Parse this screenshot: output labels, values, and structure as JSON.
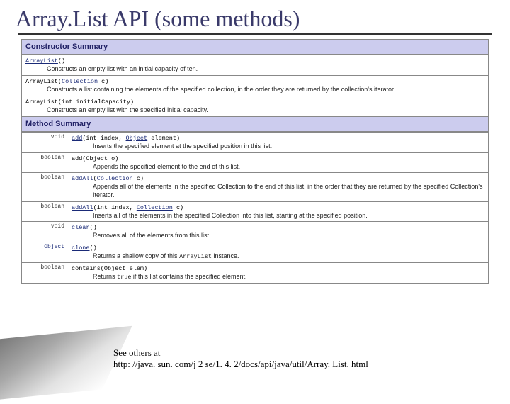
{
  "title": "Array.List API (some methods)",
  "constructor_header": "Constructor Summary",
  "method_header": "Method Summary",
  "constructors": [
    {
      "sig_pre": "ArrayList",
      "sig_post": "()",
      "desc": "Constructs an empty list with an initial capacity of ten."
    },
    {
      "sig_pre": "ArrayList",
      "sig_arg": "Collection",
      "sig_var": " c)",
      "desc": "Constructs a list containing the elements of the specified collection, in the order they are returned by the collection's iterator."
    },
    {
      "sig_pre": "ArrayList",
      "sig_post": "(int initialCapacity)",
      "desc": "Constructs an empty list with the specified initial capacity."
    }
  ],
  "methods": [
    {
      "ret": "void",
      "name": "add",
      "sig": "(int index, ",
      "argtype": "Object",
      "sig2": " element)",
      "desc": "Inserts the specified element at the specified position in this list."
    },
    {
      "ret": "boolean",
      "name_plain": "add(Object o)",
      "desc": "Appends the specified element to the end of this list."
    },
    {
      "ret": "boolean",
      "name": "addAll",
      "sig": "(",
      "argtype": "Collection",
      "sig2": " c)",
      "desc": "Appends all of the elements in the specified Collection to the end of this list, in the order that they are returned by the specified Collection's Iterator."
    },
    {
      "ret": "boolean",
      "name": "addAll",
      "sig": "(int index, ",
      "argtype": "Collection",
      "sig2": " c)",
      "desc": "Inserts all of the elements in the specified Collection into this list, starting at the specified position."
    },
    {
      "ret": "void",
      "name": "clear",
      "sig": "()",
      "desc": "Removes all of the elements from this list."
    },
    {
      "ret": "Object",
      "name": "clone",
      "sig": "()",
      "desc_pre": "Returns a shallow copy of this ",
      "desc_code": "ArrayList",
      "desc_post": " instance."
    },
    {
      "ret": "boolean",
      "name_plain": "contains(Object elem)",
      "desc_pre": "Returns ",
      "desc_code": "true",
      "desc_post": " if this list contains the specified element."
    }
  ],
  "footer_line1": "See others at",
  "footer_line2": "http: //java. sun. com/j 2 se/1. 4. 2/docs/api/java/util/Array. List. html"
}
